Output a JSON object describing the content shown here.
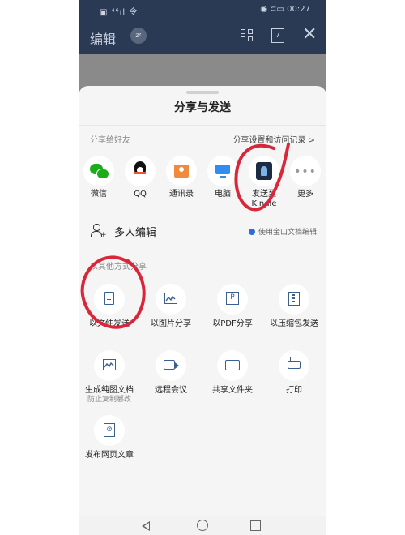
{
  "status_bar": {
    "left_icons": "▣ ⁴⁶ıl 令",
    "right_text": "◉ ⊂▭ 00:27"
  },
  "app_bar": {
    "title": "编辑",
    "sleep_badge": "zᶻ",
    "page_count": "7",
    "close": "✕"
  },
  "sheet": {
    "title": "分享与发送",
    "friends_label": "分享给好友",
    "settings_link": "分享设置和访问记录 >",
    "friends": [
      {
        "label": "微信",
        "icon": "wechat-icon"
      },
      {
        "label": "QQ",
        "icon": "qq-icon"
      },
      {
        "label": "通讯录",
        "icon": "contacts-icon"
      },
      {
        "label": "电脑",
        "icon": "computer-icon"
      },
      {
        "label": "发送至 Kindle",
        "icon": "kindle-icon"
      },
      {
        "label": "更多",
        "icon": "more-icon",
        "glyph": "•••"
      }
    ],
    "collab": {
      "label": "多人编辑",
      "note": "使用金山文档编辑",
      "plus": "+"
    },
    "other_label": "以其他方式分享",
    "options": [
      {
        "label": "以文件发送",
        "icon": "document-icon"
      },
      {
        "label": "以图片分享",
        "icon": "image-icon"
      },
      {
        "label": "以PDF分享",
        "icon": "pdf-icon",
        "glyph": "P"
      },
      {
        "label": "以压缩包发送",
        "icon": "zip-icon"
      },
      {
        "label": "生成纯图文档",
        "sub": "防止复制篡改",
        "icon": "image-document-icon"
      },
      {
        "label": "远程会议",
        "icon": "video-meeting-icon"
      },
      {
        "label": "共享文件夹",
        "icon": "shared-folder-icon"
      },
      {
        "label": "打印",
        "icon": "printer-icon"
      },
      {
        "label": "发布网页文章",
        "icon": "web-article-icon",
        "glyph": "⊘"
      }
    ]
  },
  "annotation_color": "#d9263a"
}
